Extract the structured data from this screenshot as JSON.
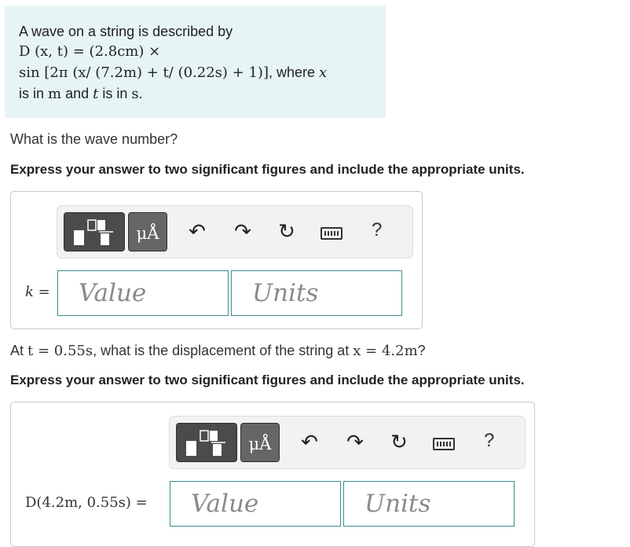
{
  "intro": {
    "line1": "A wave on a string is described by",
    "line2": "D (x, t) = (2.8cm) ×",
    "line3_math": "sin [2π (x/ (7.2m) + t/ (0.22s) + 1)]",
    "line3_text": ", where ",
    "line3_var": "x",
    "line4_a": "is in ",
    "line4_m": "m",
    "line4_b": " and ",
    "line4_t": "t",
    "line4_c": " is in ",
    "line4_s": "s",
    "line4_d": "."
  },
  "part1": {
    "question": "What is the wave number?",
    "instruction": "Express your answer to two significant figures and include the appropriate units.",
    "answer_label": "k =",
    "value_placeholder": "Value",
    "units_placeholder": "Units"
  },
  "part2": {
    "question_a": "At ",
    "question_t": "t = 0.55s",
    "question_b": ", what is the displacement of the string at ",
    "question_x": "x = 4.2m",
    "question_c": "?",
    "instruction": "Express your answer to two significant figures and include the appropriate units.",
    "answer_label": "D(4.2m, 0.55s) =",
    "value_placeholder": "Value",
    "units_placeholder": "Units"
  },
  "toolbar": {
    "units_label": "μÅ",
    "undo_icon": "↶",
    "redo_icon": "↷",
    "reset_icon": "↻",
    "help_label": "?"
  },
  "colors": {
    "intro_bg": "#e6f4f5",
    "field_border": "#3b8c8c",
    "button_dark": "#4b4b4b"
  }
}
